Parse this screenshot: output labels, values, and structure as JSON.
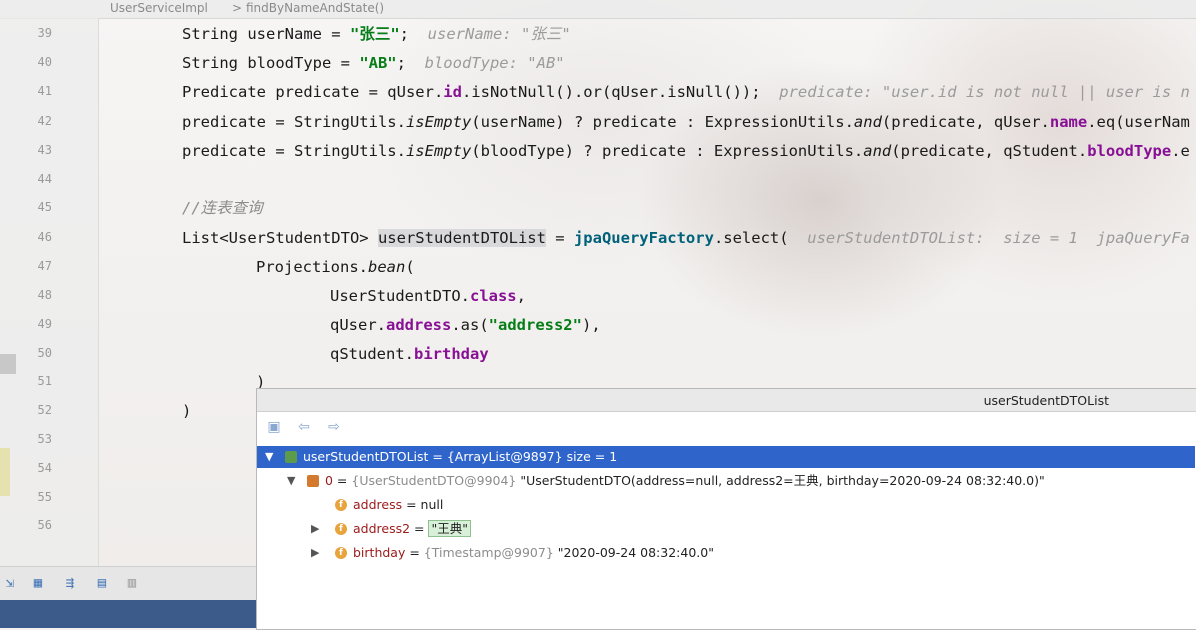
{
  "breadcrumb": {
    "class_name": "UserServiceImpl",
    "separator": ">",
    "method_name": "findByNameAndState()"
  },
  "gutter": {
    "line_numbers": [
      "39",
      "40",
      "41",
      "42",
      "43",
      "44",
      "45",
      "46",
      "47",
      "48",
      "49",
      "50",
      "51",
      "52",
      "53",
      "54",
      "55",
      "56"
    ]
  },
  "code": {
    "l39_a": "String userName = ",
    "l39_str": "\"张三\"",
    "l39_b": ";",
    "l39_hint": "  userName: \"张三\"",
    "l40_a": "String bloodType = ",
    "l40_str": "\"AB\"",
    "l40_b": ";",
    "l40_hint": "  bloodType: \"AB\"",
    "l41_a": "Predicate predicate = qUser.",
    "l41_field": "id",
    "l41_b": ".isNotNull().or(qUser.isNull());",
    "l41_hint": "  predicate: \"user.id is not null || user is n",
    "l42_a": "predicate = StringUtils.",
    "l42_static": "isEmpty",
    "l42_b": "(userName) ? predicate : ExpressionUtils.",
    "l42_static2": "and",
    "l42_c": "(predicate, qUser.",
    "l42_field": "name",
    "l42_d": ".eq(userNam",
    "l43_a": "predicate = StringUtils.",
    "l43_static": "isEmpty",
    "l43_b": "(bloodType) ? predicate : ExpressionUtils.",
    "l43_static2": "and",
    "l43_c": "(predicate, qStudent.",
    "l43_field": "bloodType",
    "l43_d": ".e",
    "l45_comment": "//连表查询",
    "l46_a": "List<UserStudentDTO> ",
    "l46_var": "userStudentDTOList",
    "l46_b": " = ",
    "l46_method": "jpaQueryFactory",
    "l46_c": ".select(",
    "l46_hint": "  userStudentDTOList:  size = 1  jpaQueryFa",
    "l47_a": "Projections.",
    "l47_static": "bean",
    "l47_b": "(",
    "l48_a": "UserStudentDTO.",
    "l48_kw": "class",
    "l48_b": ",",
    "l49_a": "qUser.",
    "l49_field": "address",
    "l49_b": ".as(",
    "l49_str": "\"address2\"",
    "l49_c": "),",
    "l50_a": "qStudent.",
    "l50_field": "birthday",
    "l51": ")",
    "l52": ")"
  },
  "popup": {
    "title": "userStudentDTOList",
    "toolbar_icons": [
      "layout-icon",
      "back-icon",
      "forward-icon"
    ],
    "root": {
      "name": "userStudentDTOList",
      "eq": " = ",
      "type": "{ArrayList@9897}",
      "size": "  size = 1"
    },
    "item0": {
      "name": "0",
      "eq": " = ",
      "type": "{UserStudentDTO@9904}",
      "value": " \"UserStudentDTO(address=null, address2=王典, birthday=2020-09-24 08:32:40.0)\""
    },
    "address": {
      "name": "address",
      "eq": " = ",
      "value": "null"
    },
    "address2": {
      "name": "address2",
      "eq": " = ",
      "value": "\"王典\""
    },
    "birthday": {
      "name": "birthday",
      "eq": " = ",
      "type": "{Timestamp@9907}",
      "value": " \"2020-09-24 08:32:40.0\""
    },
    "field_icon_letter": "f"
  },
  "colors": {
    "selection": "#2f65ca",
    "string": "#067d17",
    "field": "#871094"
  }
}
